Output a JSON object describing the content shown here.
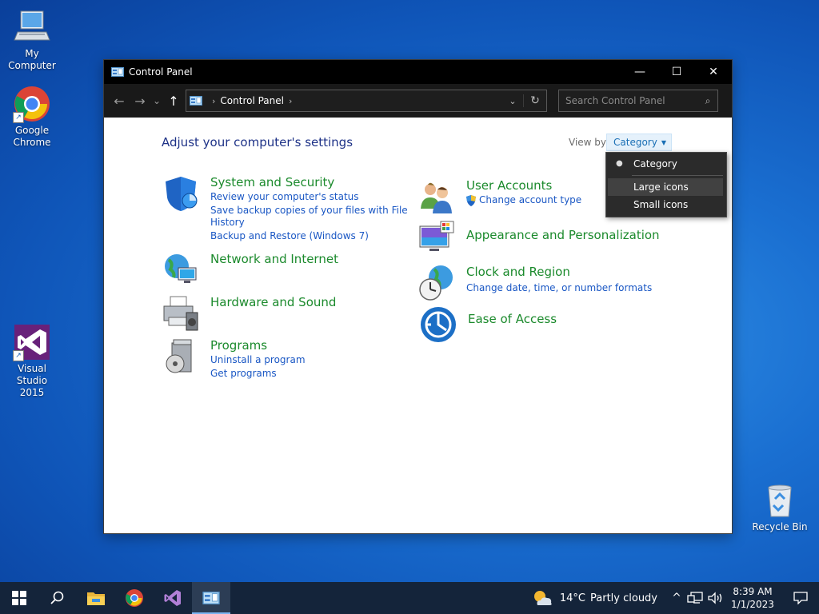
{
  "desktop": {
    "icons": [
      {
        "label": "My Computer"
      },
      {
        "label": "Google Chrome"
      },
      {
        "label": "Visual Studio 2015"
      },
      {
        "label": "Recycle Bin"
      }
    ]
  },
  "window": {
    "title": "Control Panel",
    "minimize_symbol": "—",
    "maximize_symbol": "☐",
    "close_symbol": "✕",
    "nav": {
      "back": "←",
      "forward": "→",
      "recent": "⌄",
      "up": "↑"
    },
    "address": {
      "crumb": "Control Panel",
      "separator": "›",
      "dropdown": "⌄",
      "refresh": "↻"
    },
    "search": {
      "placeholder": "Search Control Panel",
      "icon": "⌕"
    }
  },
  "content": {
    "heading": "Adjust your computer's settings",
    "view_by_label": "View by:",
    "view_by_value": "Category",
    "view_by_caret": "▼",
    "categories": [
      {
        "title": "System and Security",
        "icon": "shield-icon",
        "links": [
          "Review your computer's status",
          "Save backup copies of your files with File",
          "History",
          "Backup and Restore (Windows 7)"
        ]
      },
      {
        "title": "Network and Internet",
        "icon": "globe-network-icon",
        "links": []
      },
      {
        "title": "Hardware and Sound",
        "icon": "printer-icon",
        "links": []
      },
      {
        "title": "Programs",
        "icon": "programs-disc-icon",
        "links": [
          "Uninstall a program",
          "Get programs"
        ]
      },
      {
        "title": "User Accounts",
        "icon": "users-icon",
        "links": [
          "Change account type"
        ]
      },
      {
        "title": "Appearance and Personalization",
        "icon": "monitor-palette-icon",
        "links": []
      },
      {
        "title": "Clock and Region",
        "icon": "clock-globe-icon",
        "links": [
          "Change date, time, or number formats"
        ]
      },
      {
        "title": "Ease of Access",
        "icon": "ease-of-access-icon",
        "links": []
      }
    ]
  },
  "view_menu": {
    "items": [
      {
        "label": "Category",
        "selected": true
      },
      {
        "label": "Large icons",
        "selected": false
      },
      {
        "label": "Small icons",
        "selected": false
      }
    ],
    "bullet": "●"
  },
  "taskbar": {
    "apps": [
      "start-icon",
      "search-icon",
      "file-explorer-icon",
      "chrome-icon",
      "visual-studio-icon",
      "control-panel-icon"
    ],
    "weather": {
      "temp": "14°C",
      "condition": "Partly cloudy"
    },
    "tray_chevron": "^",
    "clock": {
      "time": "8:39 AM",
      "date": "1/1/2023"
    }
  },
  "colors": {
    "category_title": "#1b8a2c",
    "link": "#1a57c4",
    "heading": "#1e3287",
    "taskbar": "#14243a"
  }
}
